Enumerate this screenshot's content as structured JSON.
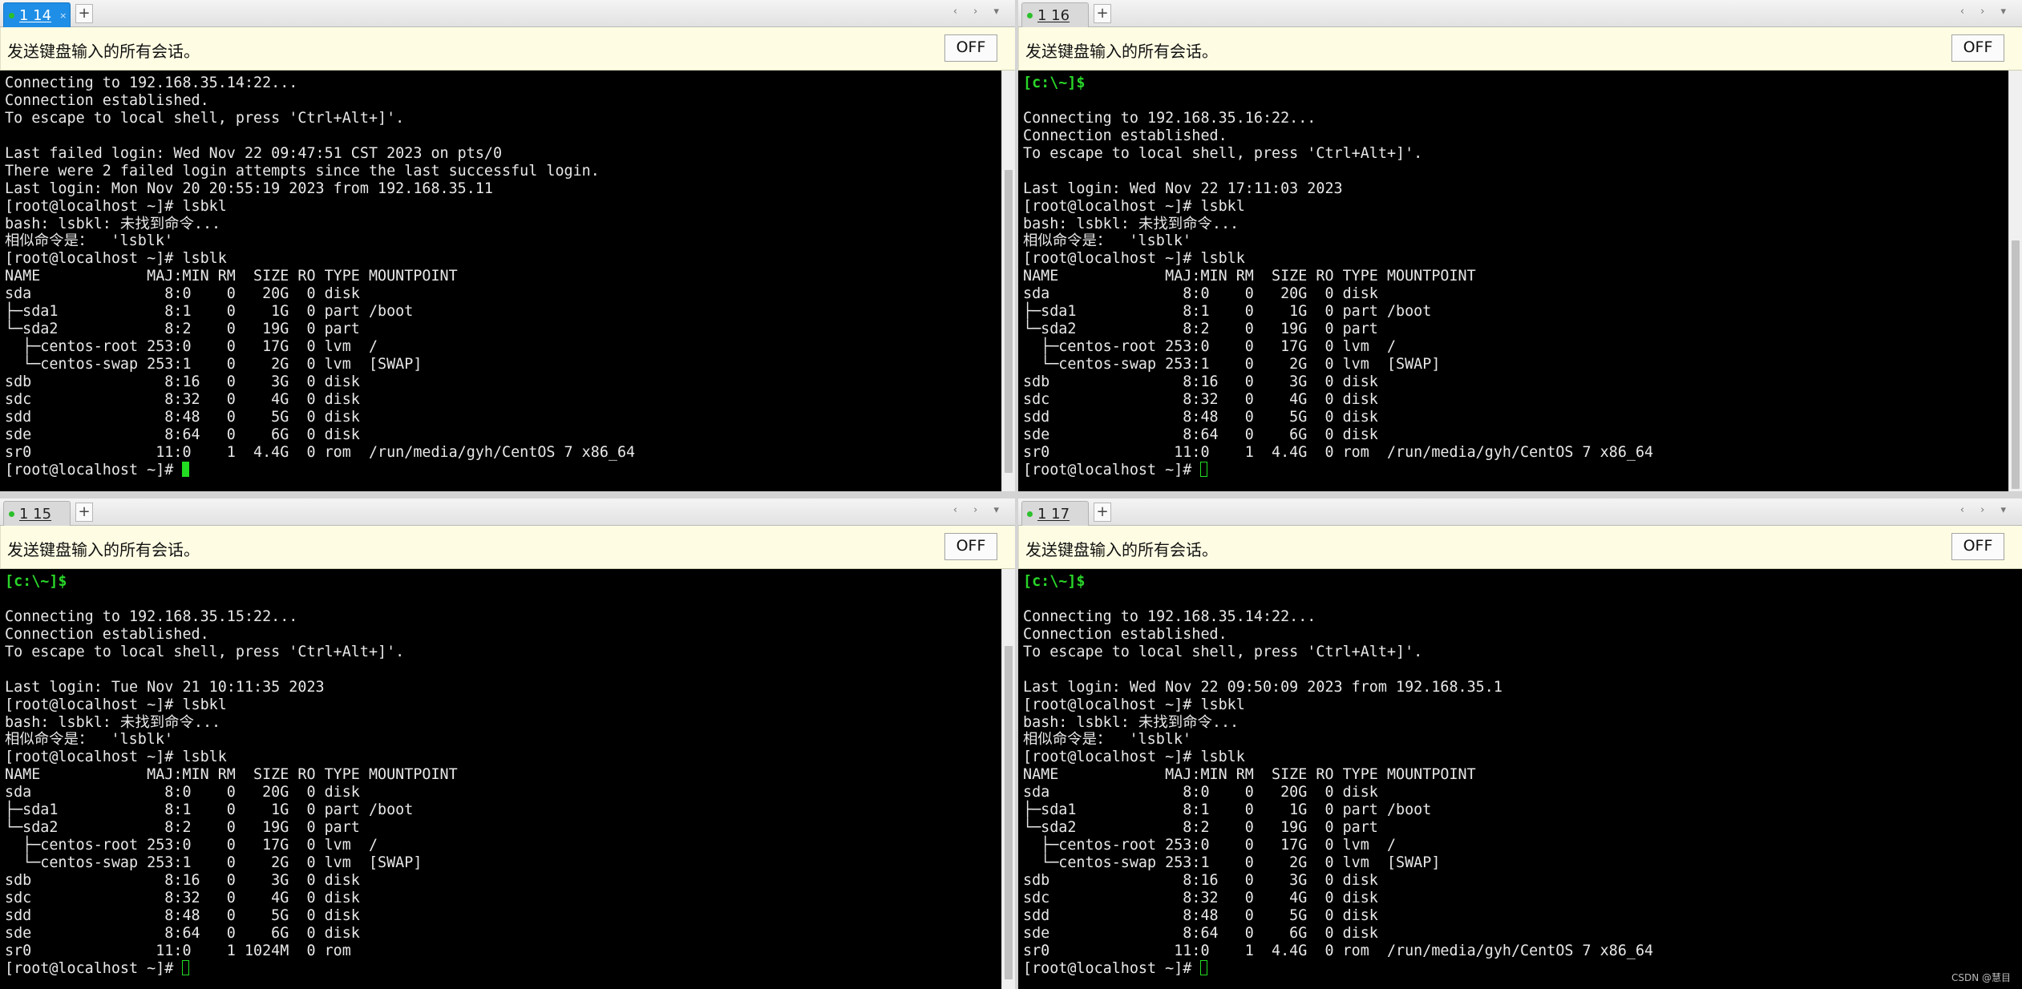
{
  "broadcast_label": "发送键盘输入的所有会话。",
  "off_label": "OFF",
  "new_tab_symbol": "+",
  "tab_nav_symbols": "‹ › ▾",
  "watermark": "CSDN @慧目",
  "panes": {
    "p1": {
      "tab": {
        "name": "1 14",
        "close": "×"
      },
      "lines": [
        "Connecting to 192.168.35.14:22...",
        "Connection established.",
        "To escape to local shell, press 'Ctrl+Alt+]'.",
        "",
        "Last failed login: Wed Nov 22 09:47:51 CST 2023 on pts/0",
        "There were 2 failed login attempts since the last successful login.",
        "Last login: Mon Nov 20 20:55:19 2023 from 192.168.35.11",
        "[root@localhost ~]# lsbkl",
        "bash: lsbkl: 未找到命令...",
        "相似命令是：  'lsblk'",
        "[root@localhost ~]# lsblk",
        "NAME            MAJ:MIN RM  SIZE RO TYPE MOUNTPOINT",
        "sda               8:0    0   20G  0 disk",
        "├─sda1            8:1    0    1G  0 part /boot",
        "└─sda2            8:2    0   19G  0 part",
        "  ├─centos-root 253:0    0   17G  0 lvm  /",
        "  └─centos-swap 253:1    0    2G  0 lvm  [SWAP]",
        "sdb               8:16   0    3G  0 disk",
        "sdc               8:32   0    4G  0 disk",
        "sdd               8:48   0    5G  0 disk",
        "sde               8:64   0    6G  0 disk",
        "sr0              11:0    1  4.4G  0 rom  /run/media/gyh/CentOS 7 x86_64"
      ],
      "prompt": "[root@localhost ~]# "
    },
    "p2": {
      "tab": {
        "name": "1 16"
      },
      "lines": [
        "[c:\\~]$",
        "",
        "Connecting to 192.168.35.16:22...",
        "Connection established.",
        "To escape to local shell, press 'Ctrl+Alt+]'.",
        "",
        "Last login: Wed Nov 22 17:11:03 2023",
        "[root@localhost ~]# lsbkl",
        "bash: lsbkl: 未找到命令...",
        "相似命令是：  'lsblk'",
        "[root@localhost ~]# lsblk",
        "NAME            MAJ:MIN RM  SIZE RO TYPE MOUNTPOINT",
        "sda               8:0    0   20G  0 disk",
        "├─sda1            8:1    0    1G  0 part /boot",
        "└─sda2            8:2    0   19G  0 part",
        "  ├─centos-root 253:0    0   17G  0 lvm  /",
        "  └─centos-swap 253:1    0    2G  0 lvm  [SWAP]",
        "sdb               8:16   0    3G  0 disk",
        "sdc               8:32   0    4G  0 disk",
        "sdd               8:48   0    5G  0 disk",
        "sde               8:64   0    6G  0 disk",
        "sr0              11:0    1  4.4G  0 rom  /run/media/gyh/CentOS 7 x86_64"
      ],
      "prompt": "[root@localhost ~]# "
    },
    "p3": {
      "tab": {
        "name": "1 15"
      },
      "lines": [
        "[c:\\~]$",
        "",
        "Connecting to 192.168.35.15:22...",
        "Connection established.",
        "To escape to local shell, press 'Ctrl+Alt+]'.",
        "",
        "Last login: Tue Nov 21 10:11:35 2023",
        "[root@localhost ~]# lsbkl",
        "bash: lsbkl: 未找到命令...",
        "相似命令是：  'lsblk'",
        "[root@localhost ~]# lsblk",
        "NAME            MAJ:MIN RM  SIZE RO TYPE MOUNTPOINT",
        "sda               8:0    0   20G  0 disk",
        "├─sda1            8:1    0    1G  0 part /boot",
        "└─sda2            8:2    0   19G  0 part",
        "  ├─centos-root 253:0    0   17G  0 lvm  /",
        "  └─centos-swap 253:1    0    2G  0 lvm  [SWAP]",
        "sdb               8:16   0    3G  0 disk",
        "sdc               8:32   0    4G  0 disk",
        "sdd               8:48   0    5G  0 disk",
        "sde               8:64   0    6G  0 disk",
        "sr0              11:0    1 1024M  0 rom"
      ],
      "prompt": "[root@localhost ~]# "
    },
    "p4": {
      "tab": {
        "name": "1 17"
      },
      "lines": [
        "[c:\\~]$",
        "",
        "Connecting to 192.168.35.14:22...",
        "Connection established.",
        "To escape to local shell, press 'Ctrl+Alt+]'.",
        "",
        "Last login: Wed Nov 22 09:50:09 2023 from 192.168.35.1",
        "[root@localhost ~]# lsbkl",
        "bash: lsbkl: 未找到命令...",
        "相似命令是：  'lsblk'",
        "[root@localhost ~]# lsblk",
        "NAME            MAJ:MIN RM  SIZE RO TYPE MOUNTPOINT",
        "sda               8:0    0   20G  0 disk",
        "├─sda1            8:1    0    1G  0 part /boot",
        "└─sda2            8:2    0   19G  0 part",
        "  ├─centos-root 253:0    0   17G  0 lvm  /",
        "  └─centos-swap 253:1    0    2G  0 lvm  [SWAP]",
        "sdb               8:16   0    3G  0 disk",
        "sdc               8:32   0    4G  0 disk",
        "sdd               8:48   0    5G  0 disk",
        "sde               8:64   0    6G  0 disk",
        "sr0              11:0    1  4.4G  0 rom  /run/media/gyh/CentOS 7 x86_64"
      ],
      "prompt": "[root@localhost ~]# "
    }
  }
}
